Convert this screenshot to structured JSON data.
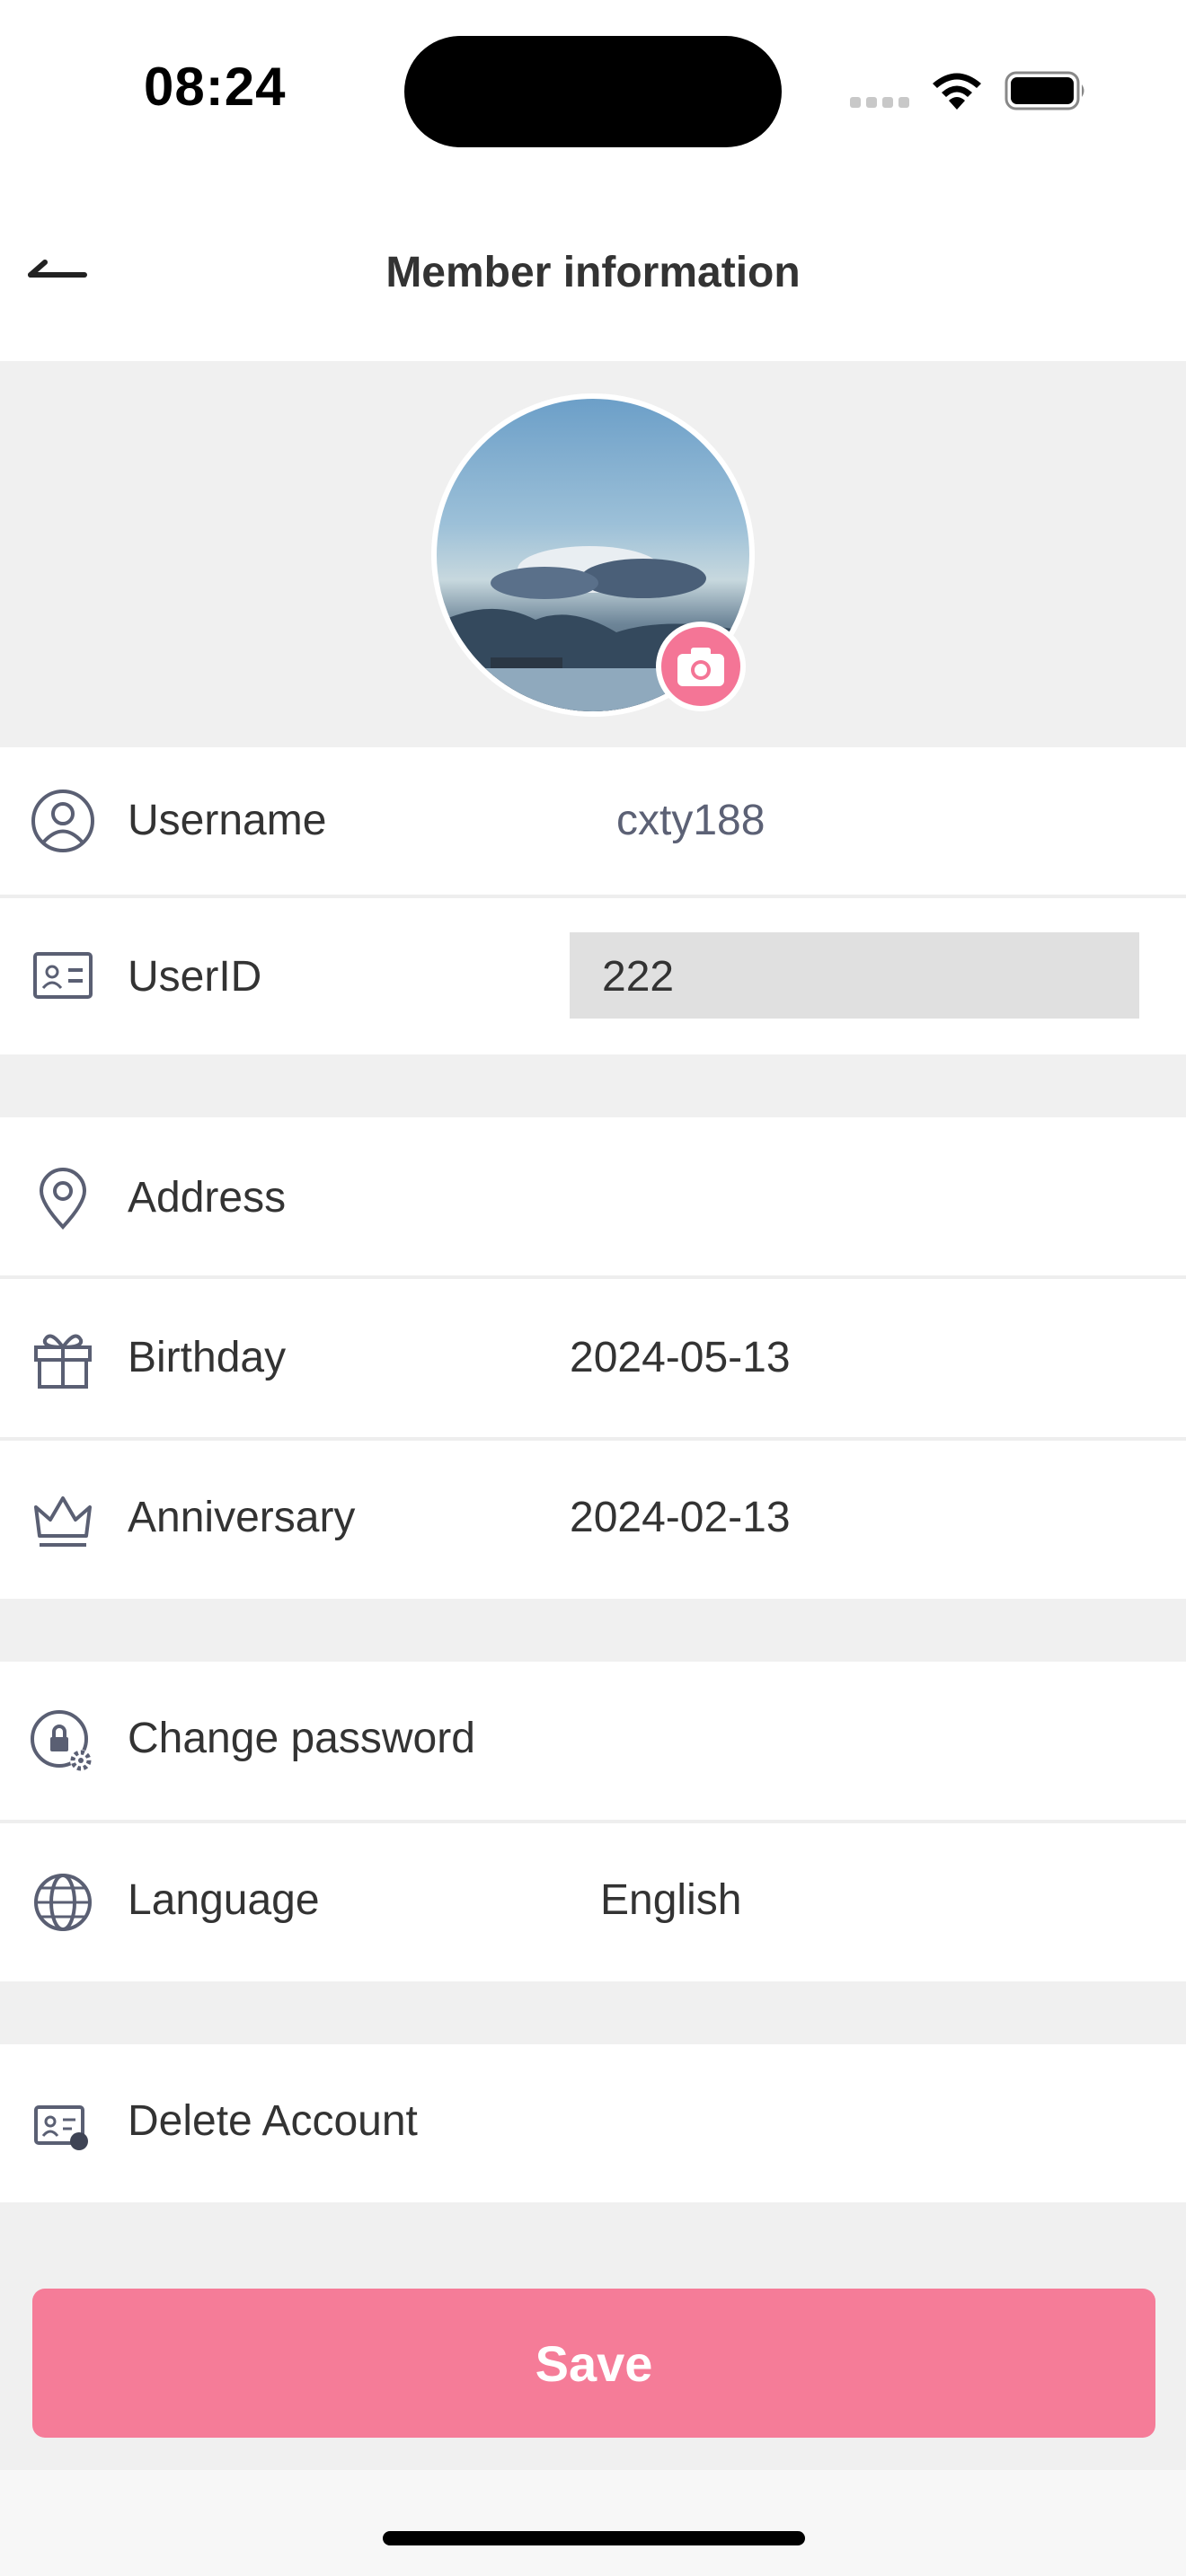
{
  "status_bar": {
    "time": "08:24"
  },
  "header": {
    "title": "Member information"
  },
  "profile": {
    "username_label": "Username",
    "username_value": "cxty188",
    "userid_label": "UserID",
    "userid_value": "222"
  },
  "details": {
    "address_label": "Address",
    "address_value": "",
    "birthday_label": "Birthday",
    "birthday_value": "2024-05-13",
    "anniversary_label": "Anniversary",
    "anniversary_value": "2024-02-13"
  },
  "settings": {
    "change_password_label": "Change password",
    "language_label": "Language",
    "language_value": "English"
  },
  "account": {
    "delete_label": "Delete Account"
  },
  "actions": {
    "save_label": "Save"
  },
  "colors": {
    "accent": "#f57c98",
    "icon": "#5a5f73",
    "muted_value": "#5c6175"
  },
  "icons": [
    "back-arrow-icon",
    "camera-icon",
    "user-circle-icon",
    "id-card-icon",
    "location-pin-icon",
    "gift-icon",
    "crown-icon",
    "lock-gear-icon",
    "globe-icon",
    "id-card-delete-icon"
  ]
}
